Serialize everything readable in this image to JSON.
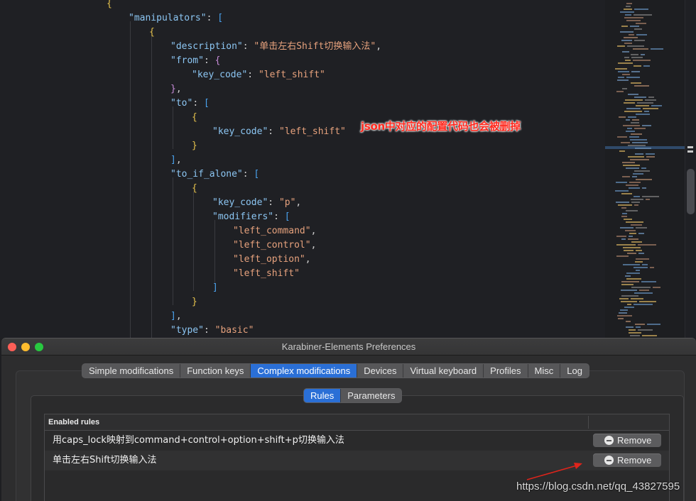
{
  "editor": {
    "lines": [
      {
        "indent": 150,
        "parts": [
          {
            "c": "b1",
            "t": "{"
          }
        ]
      },
      {
        "indent": 181,
        "parts": [
          {
            "c": "key",
            "t": "\"manipulators\""
          },
          {
            "c": "punc",
            "t": ": "
          },
          {
            "c": "b3",
            "t": "["
          }
        ]
      },
      {
        "indent": 210,
        "parts": [
          {
            "c": "b1",
            "t": "{"
          }
        ]
      },
      {
        "indent": 240,
        "parts": [
          {
            "c": "key",
            "t": "\"description\""
          },
          {
            "c": "punc",
            "t": ": "
          },
          {
            "c": "str",
            "t": "\"单击左右Shift切换输入法\""
          },
          {
            "c": "punc",
            "t": ","
          }
        ]
      },
      {
        "indent": 240,
        "parts": [
          {
            "c": "key",
            "t": "\"from\""
          },
          {
            "c": "punc",
            "t": ": "
          },
          {
            "c": "b2",
            "t": "{"
          }
        ]
      },
      {
        "indent": 270,
        "parts": [
          {
            "c": "key",
            "t": "\"key_code\""
          },
          {
            "c": "punc",
            "t": ": "
          },
          {
            "c": "str",
            "t": "\"left_shift\""
          }
        ]
      },
      {
        "indent": 240,
        "parts": [
          {
            "c": "b2",
            "t": "}"
          },
          {
            "c": "punc",
            "t": ","
          }
        ]
      },
      {
        "indent": 240,
        "parts": [
          {
            "c": "key",
            "t": "\"to\""
          },
          {
            "c": "punc",
            "t": ": "
          },
          {
            "c": "b3",
            "t": "["
          }
        ]
      },
      {
        "indent": 270,
        "parts": [
          {
            "c": "b1",
            "t": "{"
          }
        ]
      },
      {
        "indent": 299,
        "parts": [
          {
            "c": "key",
            "t": "\"key_code\""
          },
          {
            "c": "punc",
            "t": ": "
          },
          {
            "c": "str",
            "t": "\"left_shift\""
          }
        ]
      },
      {
        "indent": 270,
        "parts": [
          {
            "c": "b1",
            "t": "}"
          }
        ]
      },
      {
        "indent": 240,
        "parts": [
          {
            "c": "b3",
            "t": "]"
          },
          {
            "c": "punc",
            "t": ","
          }
        ]
      },
      {
        "indent": 240,
        "parts": [
          {
            "c": "key",
            "t": "\"to_if_alone\""
          },
          {
            "c": "punc",
            "t": ": "
          },
          {
            "c": "b3",
            "t": "["
          }
        ]
      },
      {
        "indent": 270,
        "parts": [
          {
            "c": "b1",
            "t": "{"
          }
        ]
      },
      {
        "indent": 299,
        "parts": [
          {
            "c": "key",
            "t": "\"key_code\""
          },
          {
            "c": "punc",
            "t": ": "
          },
          {
            "c": "str",
            "t": "\"p\""
          },
          {
            "c": "punc",
            "t": ","
          }
        ]
      },
      {
        "indent": 299,
        "parts": [
          {
            "c": "key",
            "t": "\"modifiers\""
          },
          {
            "c": "punc",
            "t": ": "
          },
          {
            "c": "b3",
            "t": "["
          }
        ]
      },
      {
        "indent": 328,
        "parts": [
          {
            "c": "str",
            "t": "\"left_command\""
          },
          {
            "c": "punc",
            "t": ","
          }
        ]
      },
      {
        "indent": 328,
        "parts": [
          {
            "c": "str",
            "t": "\"left_control\""
          },
          {
            "c": "punc",
            "t": ","
          }
        ]
      },
      {
        "indent": 328,
        "parts": [
          {
            "c": "str",
            "t": "\"left_option\""
          },
          {
            "c": "punc",
            "t": ","
          }
        ]
      },
      {
        "indent": 328,
        "parts": [
          {
            "c": "str",
            "t": "\"left_shift\""
          }
        ]
      },
      {
        "indent": 299,
        "parts": [
          {
            "c": "b3",
            "t": "]"
          }
        ]
      },
      {
        "indent": 270,
        "parts": [
          {
            "c": "b1",
            "t": "}"
          }
        ]
      },
      {
        "indent": 240,
        "parts": [
          {
            "c": "b3",
            "t": "]"
          },
          {
            "c": "punc",
            "t": ","
          }
        ]
      },
      {
        "indent": 240,
        "parts": [
          {
            "c": "key",
            "t": "\"type\""
          },
          {
            "c": "punc",
            "t": ": "
          },
          {
            "c": "str",
            "t": "\"basic\""
          }
        ]
      }
    ],
    "annotation": "json中对应的配置代码也会被删掉",
    "colors": {
      "key": "#8cc6f3",
      "string": "#e7a27d",
      "bracket_yellow": "#e6c34d",
      "bracket_purple": "#c78bd8",
      "bracket_blue": "#4aa3ef",
      "annotation": "#ff2a1f"
    }
  },
  "window": {
    "title": "Karabiner-Elements Preferences",
    "tabs": [
      "Simple modifications",
      "Function keys",
      "Complex modifications",
      "Devices",
      "Virtual keyboard",
      "Profiles",
      "Misc",
      "Log"
    ],
    "active_tab": "Complex modifications",
    "subtabs": [
      "Rules",
      "Parameters"
    ],
    "active_subtab": "Rules",
    "table": {
      "header": "Enabled rules",
      "rows": [
        {
          "label": "用caps_lock映射到command+control+option+shift+p切换输入法",
          "button": "Remove"
        },
        {
          "label": "单击左右Shift切换输入法",
          "button": "Remove"
        }
      ]
    },
    "accent": "#2a6fd6"
  },
  "watermark": "https://blog.csdn.net/qq_43827595"
}
